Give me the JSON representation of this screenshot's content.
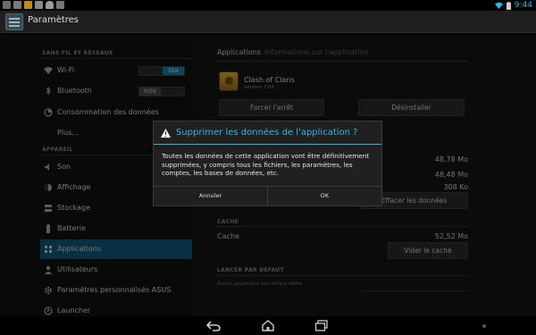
{
  "status_bar": {
    "notification_icons": [
      "screenshot-icon",
      "ready-icon",
      "clash-icon",
      "usb-icon",
      "android-icon",
      "notification-icon"
    ],
    "time": "9:44"
  },
  "action_bar": {
    "title": "Paramètres"
  },
  "sidebar": {
    "sections": [
      {
        "header": "SANS FIL ET RÉSEAUX"
      },
      {
        "header": "APPAREIL"
      }
    ],
    "items": [
      {
        "label": "Wi-Fi",
        "icon": "wifi-icon",
        "toggle": "OUI"
      },
      {
        "label": "Bluetooth",
        "icon": "bluetooth-icon",
        "toggle": "NON"
      },
      {
        "label": "Consommation des données",
        "icon": "data-usage-icon"
      },
      {
        "label": "Plus...",
        "icon": ""
      },
      {
        "label": "Son",
        "icon": "sound-icon"
      },
      {
        "label": "Affichage",
        "icon": "display-icon"
      },
      {
        "label": "Stockage",
        "icon": "storage-icon"
      },
      {
        "label": "Batterie",
        "icon": "battery-icon"
      },
      {
        "label": "Applications",
        "icon": "apps-icon",
        "selected": true
      },
      {
        "label": "Utilisateurs",
        "icon": "users-icon"
      },
      {
        "label": "Paramètres personnalisés ASUS",
        "icon": "asus-icon"
      },
      {
        "label": "Launcher",
        "icon": "launcher-icon"
      }
    ]
  },
  "app_info": {
    "tab_active": "Applications",
    "tab_inactive": "Informations sur l'application",
    "app_name": "Clash of Clans",
    "app_version": "version 7.65",
    "force_stop": "Forcer l'arrêt",
    "uninstall": "Désinstaller",
    "storage_values": [
      "48,78 Mo",
      "48,48 Mo",
      "308 Ko"
    ],
    "clear_data": "Effacer les données",
    "cache_header": "CACHE",
    "cache_label": "Cache",
    "cache_value": "52,52 Mo",
    "clear_cache": "Vider le cache",
    "default_header": "LANCER PAR DÉFAUT",
    "default_sub": "Aucun paramètre par défaut défini"
  },
  "dialog": {
    "title": "Supprimer les données de l'application ?",
    "message": "Toutes les données de cette application vont être définitivement supprimées, y compris tous les fichiers, les paramètres, les comptes, les bases de données, etc.",
    "cancel": "Annuler",
    "ok": "OK"
  },
  "colors": {
    "accent": "#33b5e5",
    "selected": "#0e5a7a"
  }
}
